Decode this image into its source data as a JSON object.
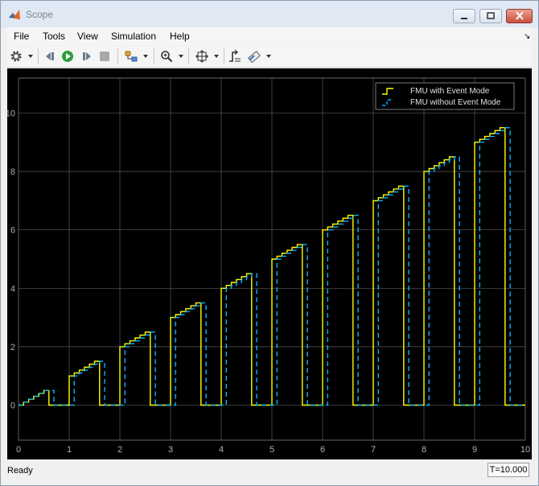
{
  "window": {
    "title": "Scope"
  },
  "menu": {
    "items": [
      "File",
      "Tools",
      "View",
      "Simulation",
      "Help"
    ]
  },
  "toolbar": {
    "icons": [
      "gear-icon",
      "step-back-icon",
      "run-icon",
      "step-forward-icon",
      "stop-icon",
      "signal-selector-icon",
      "zoom-icon",
      "fit-axes-icon",
      "triggers-icon",
      "highlight-icon"
    ]
  },
  "status": {
    "text": "Ready",
    "time": "T=10.000"
  },
  "colors": {
    "yellow": "#ffff00",
    "cyan": "#00b4ff",
    "grid": "#5a5a5a",
    "background": "#000000",
    "axes_bg": "#000000",
    "tick_label": "#b0b0b0"
  },
  "chart_data": {
    "type": "line",
    "xlim": [
      0,
      10
    ],
    "ylim": [
      -1.2,
      11.2
    ],
    "grid": true,
    "legend_placement": "top-right",
    "xticks": [
      "0",
      "1",
      "2",
      "3",
      "4",
      "5",
      "6",
      "7",
      "8",
      "9",
      "10"
    ],
    "yticks": [
      "0",
      "2",
      "4",
      "6",
      "8",
      "10"
    ],
    "series": [
      {
        "name": "FMU with Event Mode",
        "color": "#ffff00",
        "style": "solid",
        "x": [
          0.0,
          0.1,
          0.1,
          0.2,
          0.2,
          0.3,
          0.3,
          0.4,
          0.4,
          0.5,
          0.5,
          0.6,
          0.6,
          1.0,
          1.0,
          1.1,
          1.1,
          1.2,
          1.2,
          1.3,
          1.3,
          1.4,
          1.4,
          1.5,
          1.5,
          1.6,
          1.6,
          2.0,
          2.0,
          2.1,
          2.1,
          2.2,
          2.2,
          2.3,
          2.3,
          2.4,
          2.4,
          2.5,
          2.5,
          2.6,
          2.6,
          3.0,
          3.0,
          3.1,
          3.1,
          3.2,
          3.2,
          3.3,
          3.3,
          3.4,
          3.4,
          3.5,
          3.5,
          3.6,
          3.6,
          4.0,
          4.0,
          4.1,
          4.1,
          4.2,
          4.2,
          4.3,
          4.3,
          4.4,
          4.4,
          4.5,
          4.5,
          4.6,
          4.6,
          5.0,
          5.0,
          5.1,
          5.1,
          5.2,
          5.2,
          5.3,
          5.3,
          5.4,
          5.4,
          5.5,
          5.5,
          5.6,
          5.6,
          6.0,
          6.0,
          6.1,
          6.1,
          6.2,
          6.2,
          6.3,
          6.3,
          6.4,
          6.4,
          6.5,
          6.5,
          6.6,
          6.6,
          7.0,
          7.0,
          7.1,
          7.1,
          7.2,
          7.2,
          7.3,
          7.3,
          7.4,
          7.4,
          7.5,
          7.5,
          7.6,
          7.6,
          8.0,
          8.0,
          8.1,
          8.1,
          8.2,
          8.2,
          8.3,
          8.3,
          8.4,
          8.4,
          8.5,
          8.5,
          8.6,
          8.6,
          9.0,
          9.0,
          9.1,
          9.1,
          9.2,
          9.2,
          9.3,
          9.3,
          9.4,
          9.4,
          9.5,
          9.5,
          9.6,
          9.6,
          10.0
        ],
        "y": [
          0.0,
          0.0,
          0.1,
          0.1,
          0.2,
          0.2,
          0.3,
          0.3,
          0.4,
          0.4,
          0.5,
          0.5,
          0.0,
          0.0,
          1.0,
          1.0,
          1.1,
          1.1,
          1.2,
          1.2,
          1.3,
          1.3,
          1.4,
          1.4,
          1.5,
          1.5,
          0.0,
          0.0,
          2.0,
          2.0,
          2.1,
          2.1,
          2.2,
          2.2,
          2.3,
          2.3,
          2.4,
          2.4,
          2.5,
          2.5,
          0.0,
          0.0,
          3.0,
          3.0,
          3.1,
          3.1,
          3.2,
          3.2,
          3.3,
          3.3,
          3.4,
          3.4,
          3.5,
          3.5,
          0.0,
          0.0,
          4.0,
          4.0,
          4.1,
          4.1,
          4.2,
          4.2,
          4.3,
          4.3,
          4.4,
          4.4,
          4.5,
          4.5,
          0.0,
          0.0,
          5.0,
          5.0,
          5.1,
          5.1,
          5.2,
          5.2,
          5.3,
          5.3,
          5.4,
          5.4,
          5.5,
          5.5,
          0.0,
          0.0,
          6.0,
          6.0,
          6.1,
          6.1,
          6.2,
          6.2,
          6.3,
          6.3,
          6.4,
          6.4,
          6.5,
          6.5,
          0.0,
          0.0,
          7.0,
          7.0,
          7.1,
          7.1,
          7.2,
          7.2,
          7.3,
          7.3,
          7.4,
          7.4,
          7.5,
          7.5,
          0.0,
          0.0,
          8.0,
          8.0,
          8.1,
          8.1,
          8.2,
          8.2,
          8.3,
          8.3,
          8.4,
          8.4,
          8.5,
          8.5,
          0.0,
          0.0,
          9.0,
          9.0,
          9.1,
          9.1,
          9.2,
          9.2,
          9.3,
          9.3,
          9.4,
          9.4,
          9.5,
          9.5,
          0.0,
          0.0
        ]
      },
      {
        "name": "FMU without Event Mode",
        "color": "#00b4ff",
        "style": "dashed",
        "x": [
          0.0,
          0.1,
          0.1,
          0.2,
          0.2,
          0.3,
          0.3,
          0.4,
          0.4,
          0.5,
          0.5,
          0.7,
          0.7,
          1.1,
          1.1,
          1.2,
          1.2,
          1.3,
          1.3,
          1.4,
          1.4,
          1.5,
          1.5,
          1.6,
          1.6,
          1.7,
          1.7,
          2.1,
          2.1,
          2.2,
          2.2,
          2.3,
          2.3,
          2.4,
          2.4,
          2.5,
          2.5,
          2.6,
          2.6,
          2.7,
          2.7,
          3.1,
          3.1,
          3.2,
          3.2,
          3.3,
          3.3,
          3.4,
          3.4,
          3.5,
          3.5,
          3.6,
          3.6,
          3.7,
          3.7,
          4.1,
          4.1,
          4.2,
          4.2,
          4.3,
          4.3,
          4.4,
          4.4,
          4.5,
          4.5,
          4.6,
          4.6,
          4.7,
          4.7,
          5.1,
          5.1,
          5.2,
          5.2,
          5.3,
          5.3,
          5.4,
          5.4,
          5.5,
          5.5,
          5.6,
          5.6,
          5.7,
          5.7,
          6.1,
          6.1,
          6.2,
          6.2,
          6.3,
          6.3,
          6.4,
          6.4,
          6.5,
          6.5,
          6.6,
          6.6,
          6.7,
          6.7,
          7.1,
          7.1,
          7.2,
          7.2,
          7.3,
          7.3,
          7.4,
          7.4,
          7.5,
          7.5,
          7.6,
          7.6,
          7.7,
          7.7,
          8.1,
          8.1,
          8.2,
          8.2,
          8.3,
          8.3,
          8.4,
          8.4,
          8.5,
          8.5,
          8.6,
          8.6,
          8.7,
          8.7,
          9.1,
          9.1,
          9.2,
          9.2,
          9.3,
          9.3,
          9.4,
          9.4,
          9.5,
          9.5,
          9.6,
          9.6,
          9.7,
          9.7,
          10.0
        ],
        "y": [
          0.0,
          0.0,
          0.1,
          0.1,
          0.2,
          0.2,
          0.3,
          0.3,
          0.4,
          0.4,
          0.5,
          0.5,
          0.0,
          0.0,
          1.0,
          1.0,
          1.1,
          1.1,
          1.2,
          1.2,
          1.3,
          1.3,
          1.4,
          1.4,
          1.5,
          1.5,
          0.0,
          0.0,
          2.0,
          2.0,
          2.1,
          2.1,
          2.2,
          2.2,
          2.3,
          2.3,
          2.4,
          2.4,
          2.5,
          2.5,
          0.0,
          0.0,
          3.0,
          3.0,
          3.1,
          3.1,
          3.2,
          3.2,
          3.3,
          3.3,
          3.4,
          3.4,
          3.5,
          3.5,
          0.0,
          0.0,
          4.0,
          4.0,
          4.1,
          4.1,
          4.2,
          4.2,
          4.3,
          4.3,
          4.4,
          4.4,
          4.5,
          4.5,
          0.0,
          0.0,
          5.0,
          5.0,
          5.1,
          5.1,
          5.2,
          5.2,
          5.3,
          5.3,
          5.4,
          5.4,
          5.5,
          5.5,
          0.0,
          0.0,
          6.0,
          6.0,
          6.1,
          6.1,
          6.2,
          6.2,
          6.3,
          6.3,
          6.4,
          6.4,
          6.5,
          6.5,
          0.0,
          0.0,
          7.0,
          7.0,
          7.1,
          7.1,
          7.2,
          7.2,
          7.3,
          7.3,
          7.4,
          7.4,
          7.5,
          7.5,
          0.0,
          0.0,
          8.0,
          8.0,
          8.1,
          8.1,
          8.2,
          8.2,
          8.3,
          8.3,
          8.4,
          8.4,
          8.5,
          8.5,
          0.0,
          0.0,
          9.0,
          9.0,
          9.1,
          9.1,
          9.2,
          9.2,
          9.3,
          9.3,
          9.4,
          9.4,
          9.5,
          9.5,
          0.0,
          0.0
        ]
      }
    ]
  }
}
